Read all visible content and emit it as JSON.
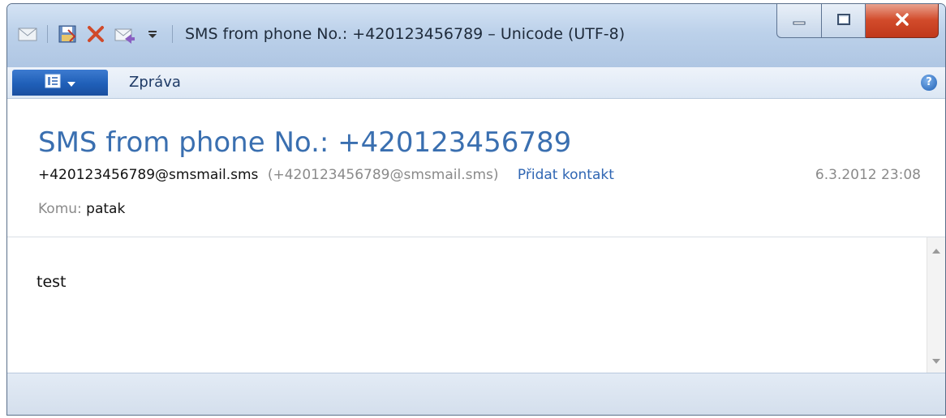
{
  "window": {
    "title": "SMS from phone No.: +420123456789 – Unicode (UTF-8)"
  },
  "ribbon": {
    "tab_message": "Zpráva",
    "help_glyph": "?"
  },
  "message": {
    "subject": "SMS from phone No.: +420123456789",
    "from_address": "+420123456789@smsmail.sms",
    "from_alt": "(+420123456789@smsmail.sms)",
    "add_contact": "Přidat kontakt",
    "datetime": "6.3.2012 23:08",
    "to_label": "Komu:",
    "to_value": "patak",
    "body": "test"
  },
  "icons": {
    "qat": [
      "envelope-icon",
      "save-icon",
      "delete-icon",
      "reply-icon",
      "customize-dropdown-icon"
    ],
    "window_buttons": [
      "minimize-icon",
      "maximize-icon",
      "close-icon"
    ]
  },
  "colors": {
    "subject_blue": "#3a6fb0",
    "link_blue": "#2f66b3",
    "file_button_blue": "#1f5fb8",
    "close_red": "#c0381b"
  }
}
